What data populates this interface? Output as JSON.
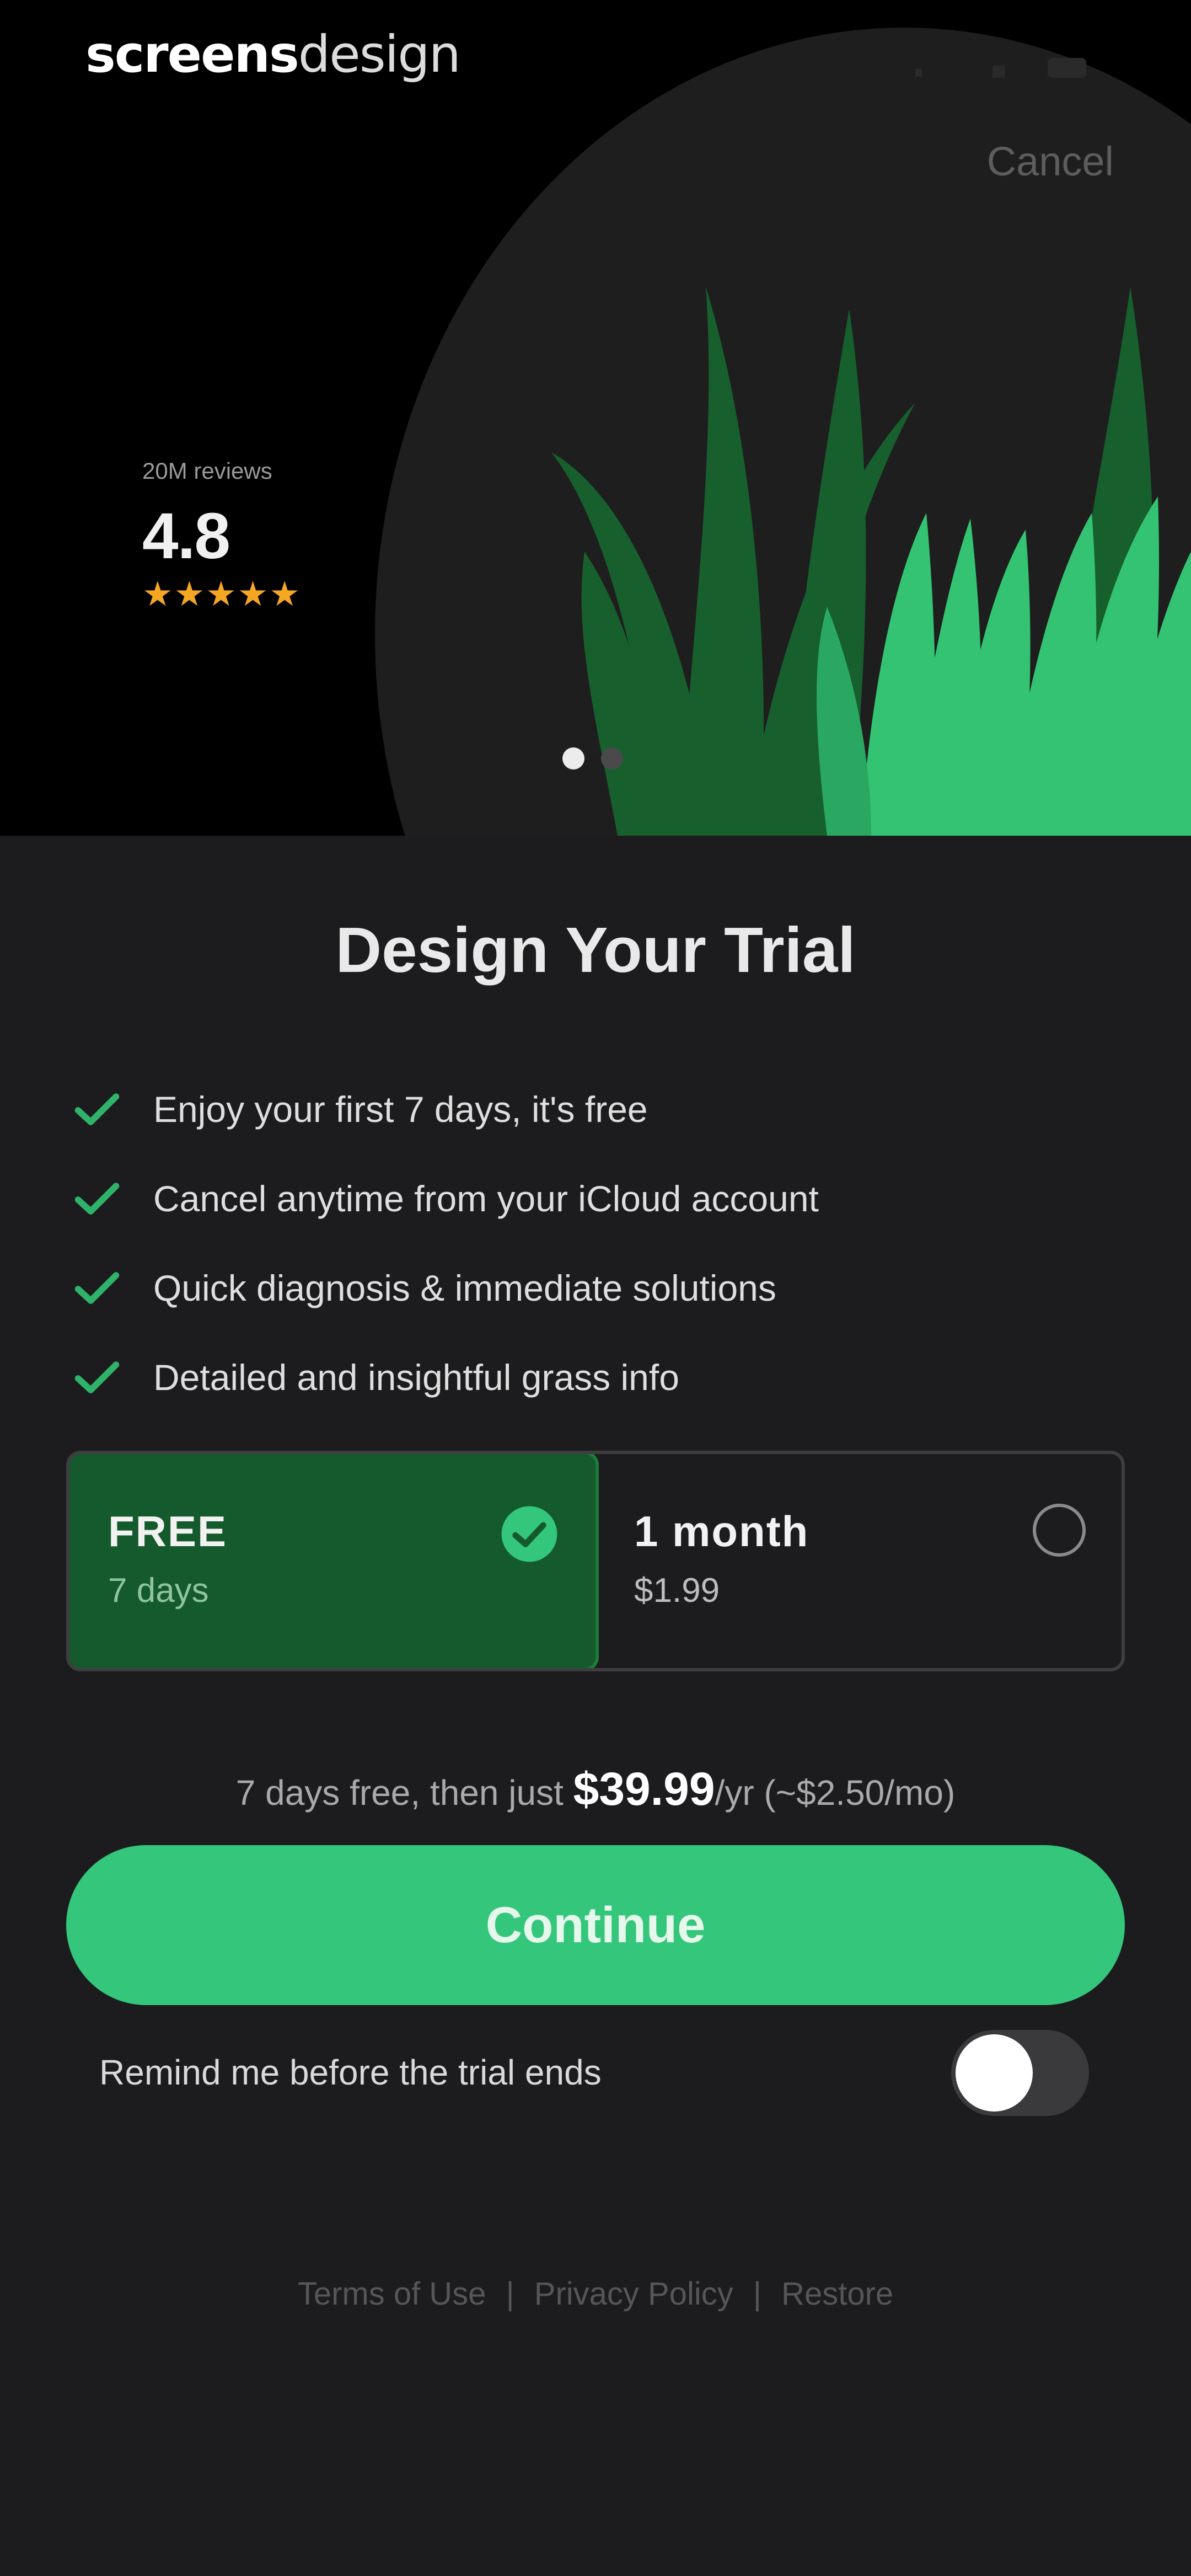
{
  "brand": {
    "part1": "screens",
    "part2": "design"
  },
  "hero": {
    "cancel_label": "Cancel",
    "rating": {
      "reviews": "20M reviews",
      "score": "4.8",
      "stars": "★★★★★"
    },
    "carousel": {
      "active_index": 0,
      "count": 2
    }
  },
  "title": "Design Your Trial",
  "features": [
    "Enjoy your first 7 days, it's free",
    "Cancel anytime from your iCloud account",
    "Quick diagnosis & immediate solutions",
    "Detailed and insightful grass info"
  ],
  "plans": [
    {
      "name": "FREE",
      "sub": "7 days",
      "selected": true
    },
    {
      "name": "1 month",
      "sub": "$1.99",
      "selected": false
    }
  ],
  "price": {
    "before": "7 days free, then just ",
    "amount": "$39.99",
    "after": "/yr (~$2.50/mo)"
  },
  "continue_label": "Continue",
  "remind": {
    "label": "Remind me before the trial ends",
    "enabled": false
  },
  "links": {
    "terms": "Terms of Use",
    "privacy": "Privacy Policy",
    "restore": "Restore",
    "separator": "|"
  },
  "colors": {
    "accent": "#34c77b",
    "selected_plan_bg": "#155a2d",
    "background": "#1c1c1e",
    "stars": "#f5a623"
  }
}
